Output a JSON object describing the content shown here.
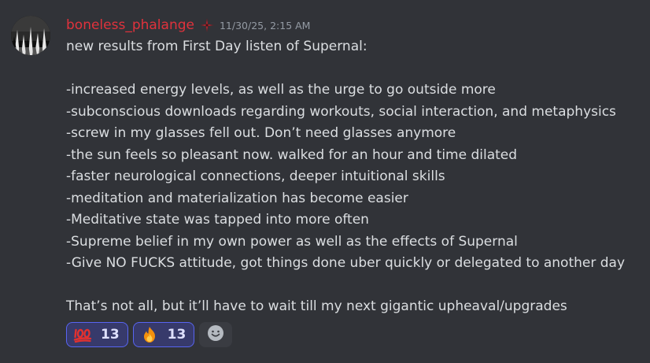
{
  "author": {
    "username": "boneless_phalange",
    "name_color": "#e0323c",
    "avatar_icon": "dark-forest-avatar",
    "role_icon": "red-cross-role-icon"
  },
  "timestamp": "11/30/25, 2:15 AM",
  "message": {
    "lines": [
      "new results from First Day listen of Supernal:",
      "",
      "-increased energy levels, as well as the urge to go outside more",
      "-subconscious downloads regarding workouts, social interaction, and metaphysics",
      "-screw in my glasses fell out. Don’t need glasses anymore",
      "-the sun feels so pleasant now. walked for an hour and time dilated",
      "-faster neurological connections, deeper intuitional skills",
      "-meditation and materialization has become easier",
      "-Meditative state was tapped into more often",
      "-Supreme belief in my own power as well as the effects of Supernal",
      "-Give NO FUCKS attitude, got things done uber quickly or delegated to another day",
      "",
      "That’s not all, but it’ll have to wait till my next gigantic upheaval/upgrades"
    ]
  },
  "reactions": [
    {
      "emoji": "hundred-points-icon",
      "count": "13"
    },
    {
      "emoji": "fire-icon",
      "count": "13"
    }
  ],
  "add_reaction_icon": "smiley-add-reaction-icon",
  "colors": {
    "background": "#313338",
    "text": "#dbdee1",
    "timestamp": "#949ba4",
    "reaction_border": "#5865f2",
    "reaction_bg": "#373a6b"
  }
}
